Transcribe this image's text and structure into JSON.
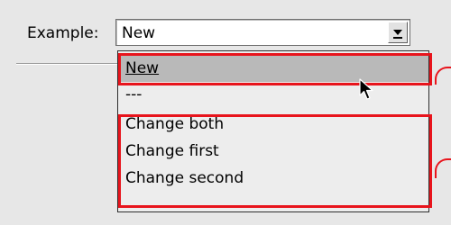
{
  "form": {
    "example_label": "Example:",
    "combo_value": "New"
  },
  "dropdown": {
    "items": [
      {
        "label": "New",
        "selected": true
      },
      {
        "label": "---",
        "selected": false
      },
      {
        "label": "Change both",
        "selected": false
      },
      {
        "label": "Change first",
        "selected": false
      },
      {
        "label": "Change second",
        "selected": false
      }
    ]
  },
  "annotations": {
    "highlight_color": "#e8141c"
  },
  "icons": {
    "combo_arrow": "chevron-down-icon",
    "pointer": "mouse-cursor-icon"
  }
}
